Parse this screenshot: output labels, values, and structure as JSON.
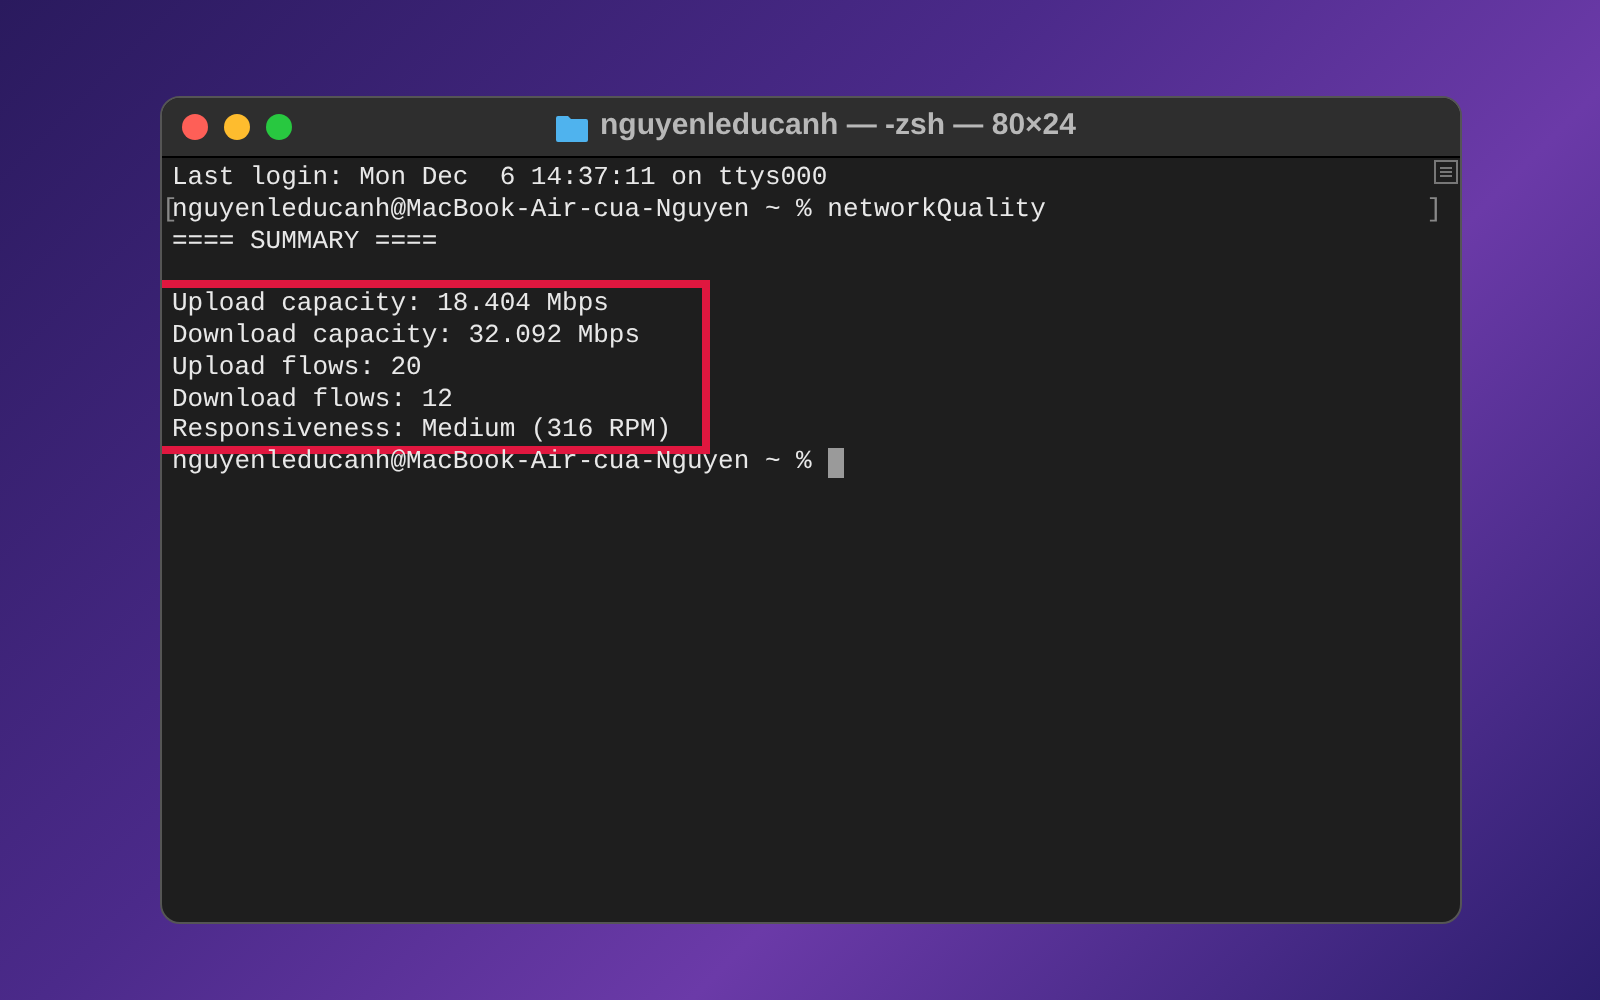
{
  "window": {
    "title": "nguyenleducanh — -zsh — 80×24"
  },
  "terminal": {
    "lines": [
      "Last login: Mon Dec  6 14:37:11 on ttys000"
    ],
    "marked_line": {
      "open": "[",
      "text": "nguyenleducanh@MacBook-Air-cua-Nguyen ~ % networkQuality",
      "close": "]"
    },
    "summary": "==== SUMMARY ====",
    "highlighted_lines": [
      "Upload capacity: 18.404 Mbps",
      "Download capacity: 32.092 Mbps",
      "Upload flows: 20",
      "Download flows: 12",
      "Responsiveness: Medium (316 RPM)"
    ],
    "prompt": {
      "text": "nguyenleducanh@MacBook-Air-cua-Nguyen ~ %",
      "cursor": true
    }
  }
}
